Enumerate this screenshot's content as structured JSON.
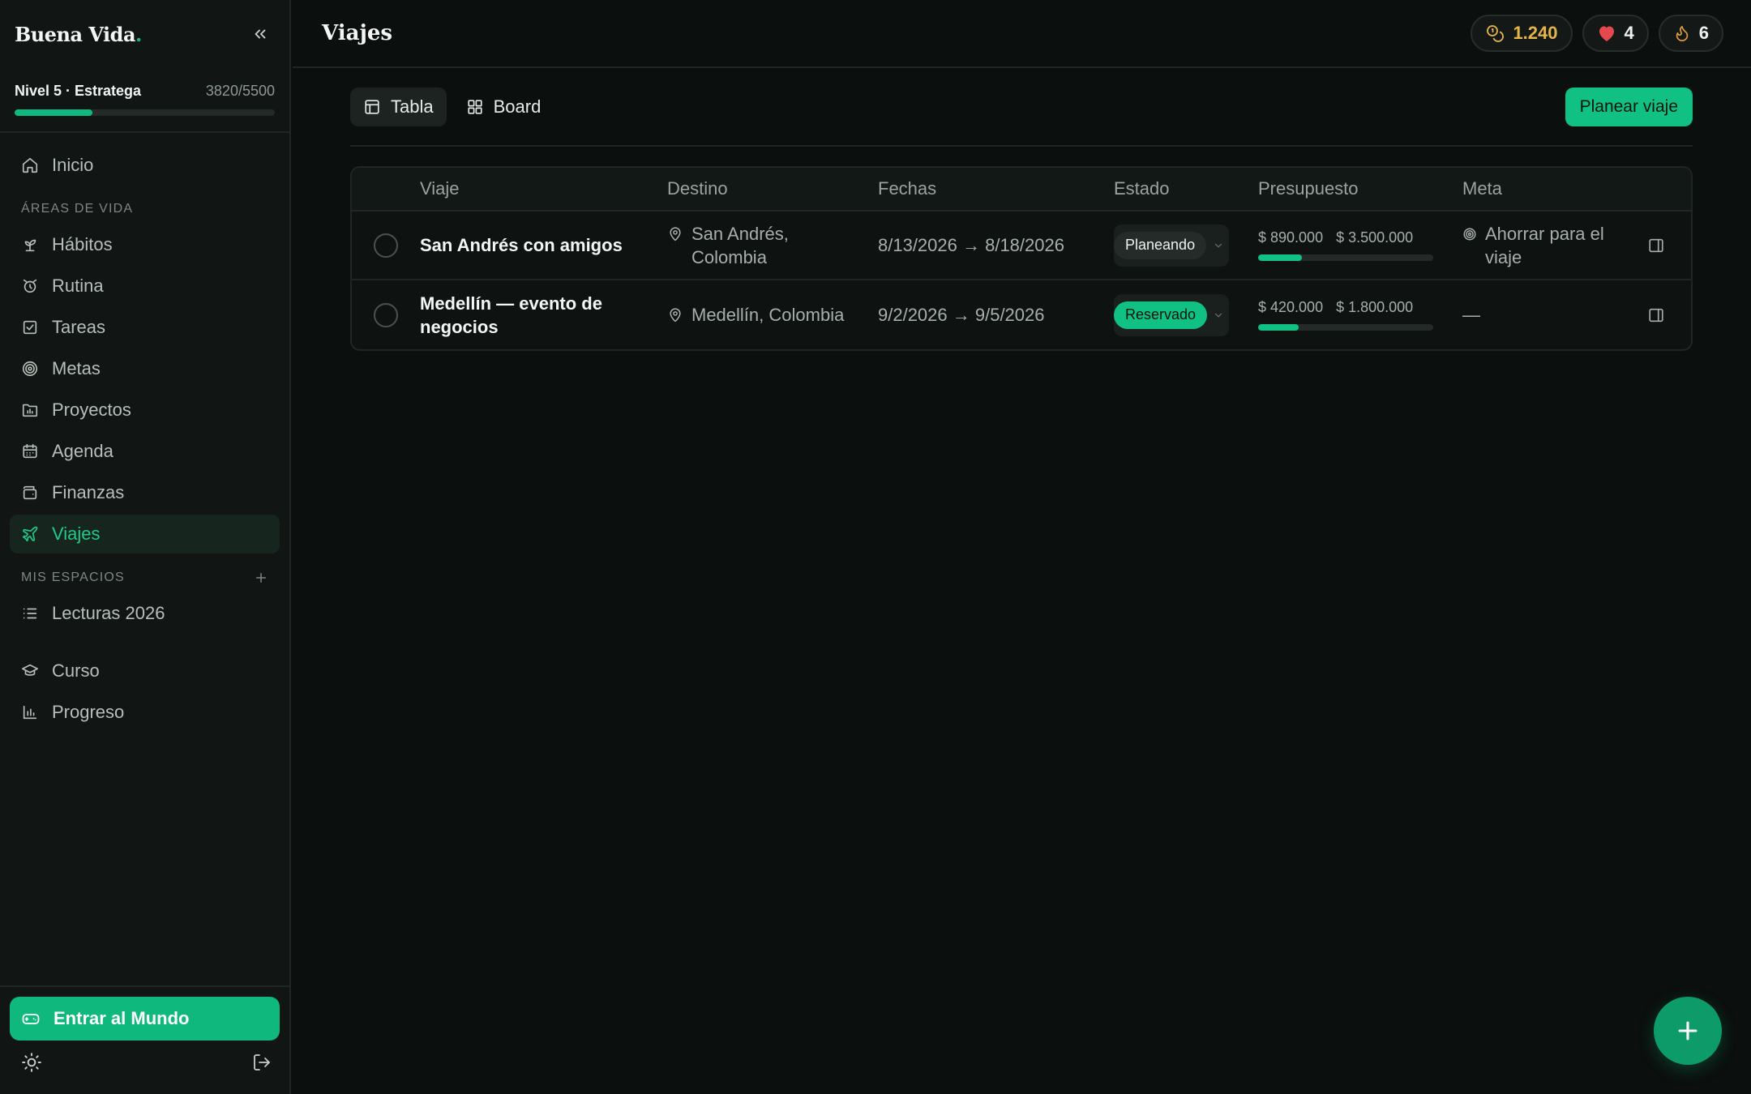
{
  "app": {
    "brand": "Buena Vida",
    "brand_dot": "."
  },
  "level": {
    "label": "Nivel 5 · Estratega",
    "xp": "3820/5500",
    "progress": 0.3
  },
  "nav": {
    "inicio": "Inicio",
    "areas_label": "ÁREAS DE VIDA",
    "items": [
      "Hábitos",
      "Rutina",
      "Tareas",
      "Metas",
      "Proyectos",
      "Agenda",
      "Finanzas",
      "Viajes"
    ],
    "spaces_label": "MIS ESPACIOS",
    "spaces": [
      "Lecturas 2026"
    ],
    "extra": [
      "Curso",
      "Progreso"
    ]
  },
  "sidebar_bottom": {
    "enter_label": "Entrar al Mundo"
  },
  "header": {
    "title": "Viajes",
    "stats": {
      "coins": "1.240",
      "hearts": "4",
      "streak": "6"
    }
  },
  "toolbar": {
    "views": [
      "Tabla",
      "Board"
    ],
    "active_view": "Tabla",
    "primary_label": "Planear viaje"
  },
  "table": {
    "columns": [
      "Viaje",
      "Destino",
      "Fechas",
      "Estado",
      "Presupuesto",
      "Meta"
    ],
    "rows": [
      {
        "trip": "San Andrés con amigos",
        "destination": "San Andrés, Colombia",
        "dates": "8/13/2026 → 8/18/2026",
        "status": "Planeando",
        "spent": "$ 890.000",
        "budget": "$ 3.500.000",
        "budget_progress": 0.25,
        "goal": "Ahorrar para el viaje"
      },
      {
        "trip": "Medellín — evento de negocios",
        "destination": "Medellín, Colombia",
        "dates": "9/2/2026 → 9/5/2026",
        "status": "Reservado",
        "spent": "$ 420.000",
        "budget": "$ 1.800.000",
        "budget_progress": 0.23,
        "goal": "—"
      }
    ]
  },
  "colors": {
    "accent": "#10c183",
    "background": "#0b0f0d",
    "sidebar": "#111614",
    "coins": "#e6b54a",
    "heart": "#e5484d"
  }
}
